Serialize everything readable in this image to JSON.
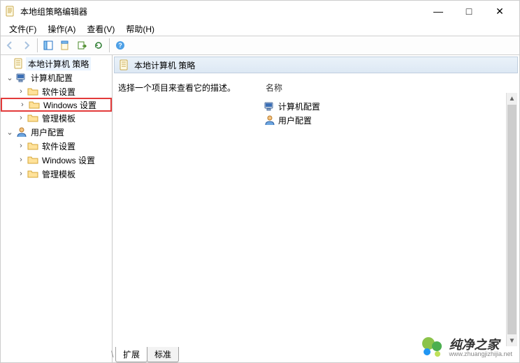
{
  "window": {
    "title": "本地组策略编辑器",
    "controls": {
      "min": "—",
      "max": "□",
      "close": "✕"
    }
  },
  "menubar": {
    "file": "文件(F)",
    "action": "操作(A)",
    "view": "查看(V)",
    "help": "帮助(H)"
  },
  "tree": {
    "root": "本地计算机 策略",
    "computer_cfg": "计算机配置",
    "c_software": "软件设置",
    "c_windows": "Windows 设置",
    "c_admin": "管理模板",
    "user_cfg": "用户配置",
    "u_software": "软件设置",
    "u_windows": "Windows 设置",
    "u_admin": "管理模板"
  },
  "content": {
    "header": "本地计算机 策略",
    "desc_prompt": "选择一个项目来查看它的描述。",
    "name_header": "名称",
    "items": {
      "computer_cfg": "计算机配置",
      "user_cfg": "用户配置"
    }
  },
  "tabs": {
    "extended": "扩展",
    "standard": "标准"
  },
  "watermark": {
    "text": "纯净之家",
    "url": "www.zhuangjizhijia.net"
  }
}
